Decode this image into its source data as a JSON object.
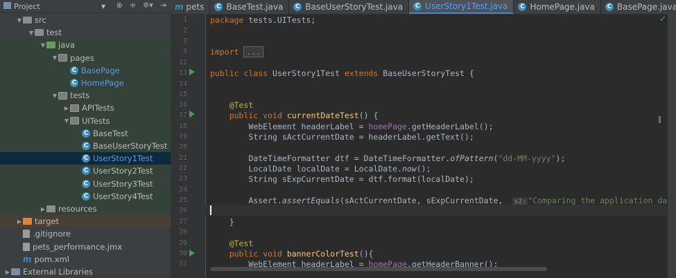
{
  "project": {
    "title": "Project",
    "tree": [
      {
        "label": "src",
        "type": "folder",
        "depth": 1,
        "open": true
      },
      {
        "label": "test",
        "type": "folder",
        "depth": 2,
        "open": true
      },
      {
        "label": "java",
        "type": "src-green",
        "depth": 3,
        "open": true
      },
      {
        "label": "pages",
        "type": "pkg",
        "depth": 4,
        "open": true
      },
      {
        "label": "BasePage",
        "type": "class",
        "depth": 5
      },
      {
        "label": "HomePage",
        "type": "class",
        "depth": 5
      },
      {
        "label": "tests",
        "type": "pkg",
        "depth": 4,
        "open": true
      },
      {
        "label": "APITests",
        "type": "pkg",
        "depth": 5,
        "open": false
      },
      {
        "label": "UITests",
        "type": "pkg",
        "depth": 5,
        "open": true
      },
      {
        "label": "BaseTest",
        "type": "class",
        "depth": 6
      },
      {
        "label": "BaseUserStoryTest",
        "type": "class",
        "depth": 6
      },
      {
        "label": "UserStory1Test",
        "type": "class",
        "depth": 6,
        "selected": true
      },
      {
        "label": "UserStory2Test",
        "type": "class",
        "depth": 6
      },
      {
        "label": "UserStory3Test",
        "type": "class",
        "depth": 6
      },
      {
        "label": "UserStory4Test",
        "type": "class",
        "depth": 6
      },
      {
        "label": "resources",
        "type": "folder",
        "depth": 3,
        "open": false
      },
      {
        "label": "target",
        "type": "orange",
        "depth": 1,
        "open": false
      },
      {
        "label": ".gitignore",
        "type": "file",
        "depth": 1
      },
      {
        "label": "pets_performance.jmx",
        "type": "file",
        "depth": 1
      },
      {
        "label": "pom.xml",
        "type": "m",
        "depth": 1
      },
      {
        "label": "External Libraries",
        "type": "lib",
        "depth": 0,
        "open": false
      }
    ]
  },
  "tabs": [
    {
      "label": "pets",
      "icon": "m"
    },
    {
      "label": "BaseTest.java",
      "icon": "c"
    },
    {
      "label": "BaseUserStoryTest.java",
      "icon": "c"
    },
    {
      "label": "UserStory1Test.java",
      "icon": "c",
      "active": true
    },
    {
      "label": "HomePage.java",
      "icon": "c"
    },
    {
      "label": "BasePage.java",
      "icon": "c"
    }
  ],
  "lines": [
    "1",
    "2",
    "3",
    "4",
    "12",
    "13",
    "14",
    "15",
    "16",
    "17",
    "18",
    "19",
    "20",
    "21",
    "22",
    "23",
    "24",
    "25",
    "26",
    "27",
    "28",
    "29",
    "30",
    "31"
  ],
  "code": {
    "l1a": "package",
    "l1b": " tests.UITests;",
    "l4a": "import",
    "l4b": "...",
    "l13a": "public",
    "l13b": "class",
    "l13c": " UserStory1Test ",
    "l13d": "extends",
    "l13e": " BaseUserStoryTest {",
    "ann": "@Test",
    "l17a": "public",
    "l17b": "void",
    "l17c": "currentDateTest",
    "l17d": "() {",
    "l18a": "WebElement headerLabel = ",
    "l18b": "homePage",
    "l18c": ".getHeaderLabel();",
    "l19": "String sActCurrentDate = headerLabel.getText();",
    "l21a": "DateTimeFormatter dtf = DateTimeFormatter.",
    "l21b": "ofPattern",
    "l21c": "(",
    "l21d": "\"dd-MM-yyyy\"",
    "l21e": ");",
    "l22a": "LocalDate localDate = LocalDate.",
    "l22b": "now",
    "l22c": "();",
    "l23": "String sExpCurrentDate = dtf.format(localDate);",
    "l25a": "Assert.",
    "l25b": "assertEquals",
    "l25c": "(sActCurrentDate, sExpCurrentDate, ",
    "l25h": "s2:",
    "l25d": "\"Comparing the application dat",
    "l27": "}",
    "l30a": "public",
    "l30b": "void",
    "l30c": "bannerColorTest",
    "l30d": "(){",
    "l31a": "WebElement headerLabel = ",
    "l31b": "homePage",
    "l31c": ".getHeaderBanner();"
  }
}
